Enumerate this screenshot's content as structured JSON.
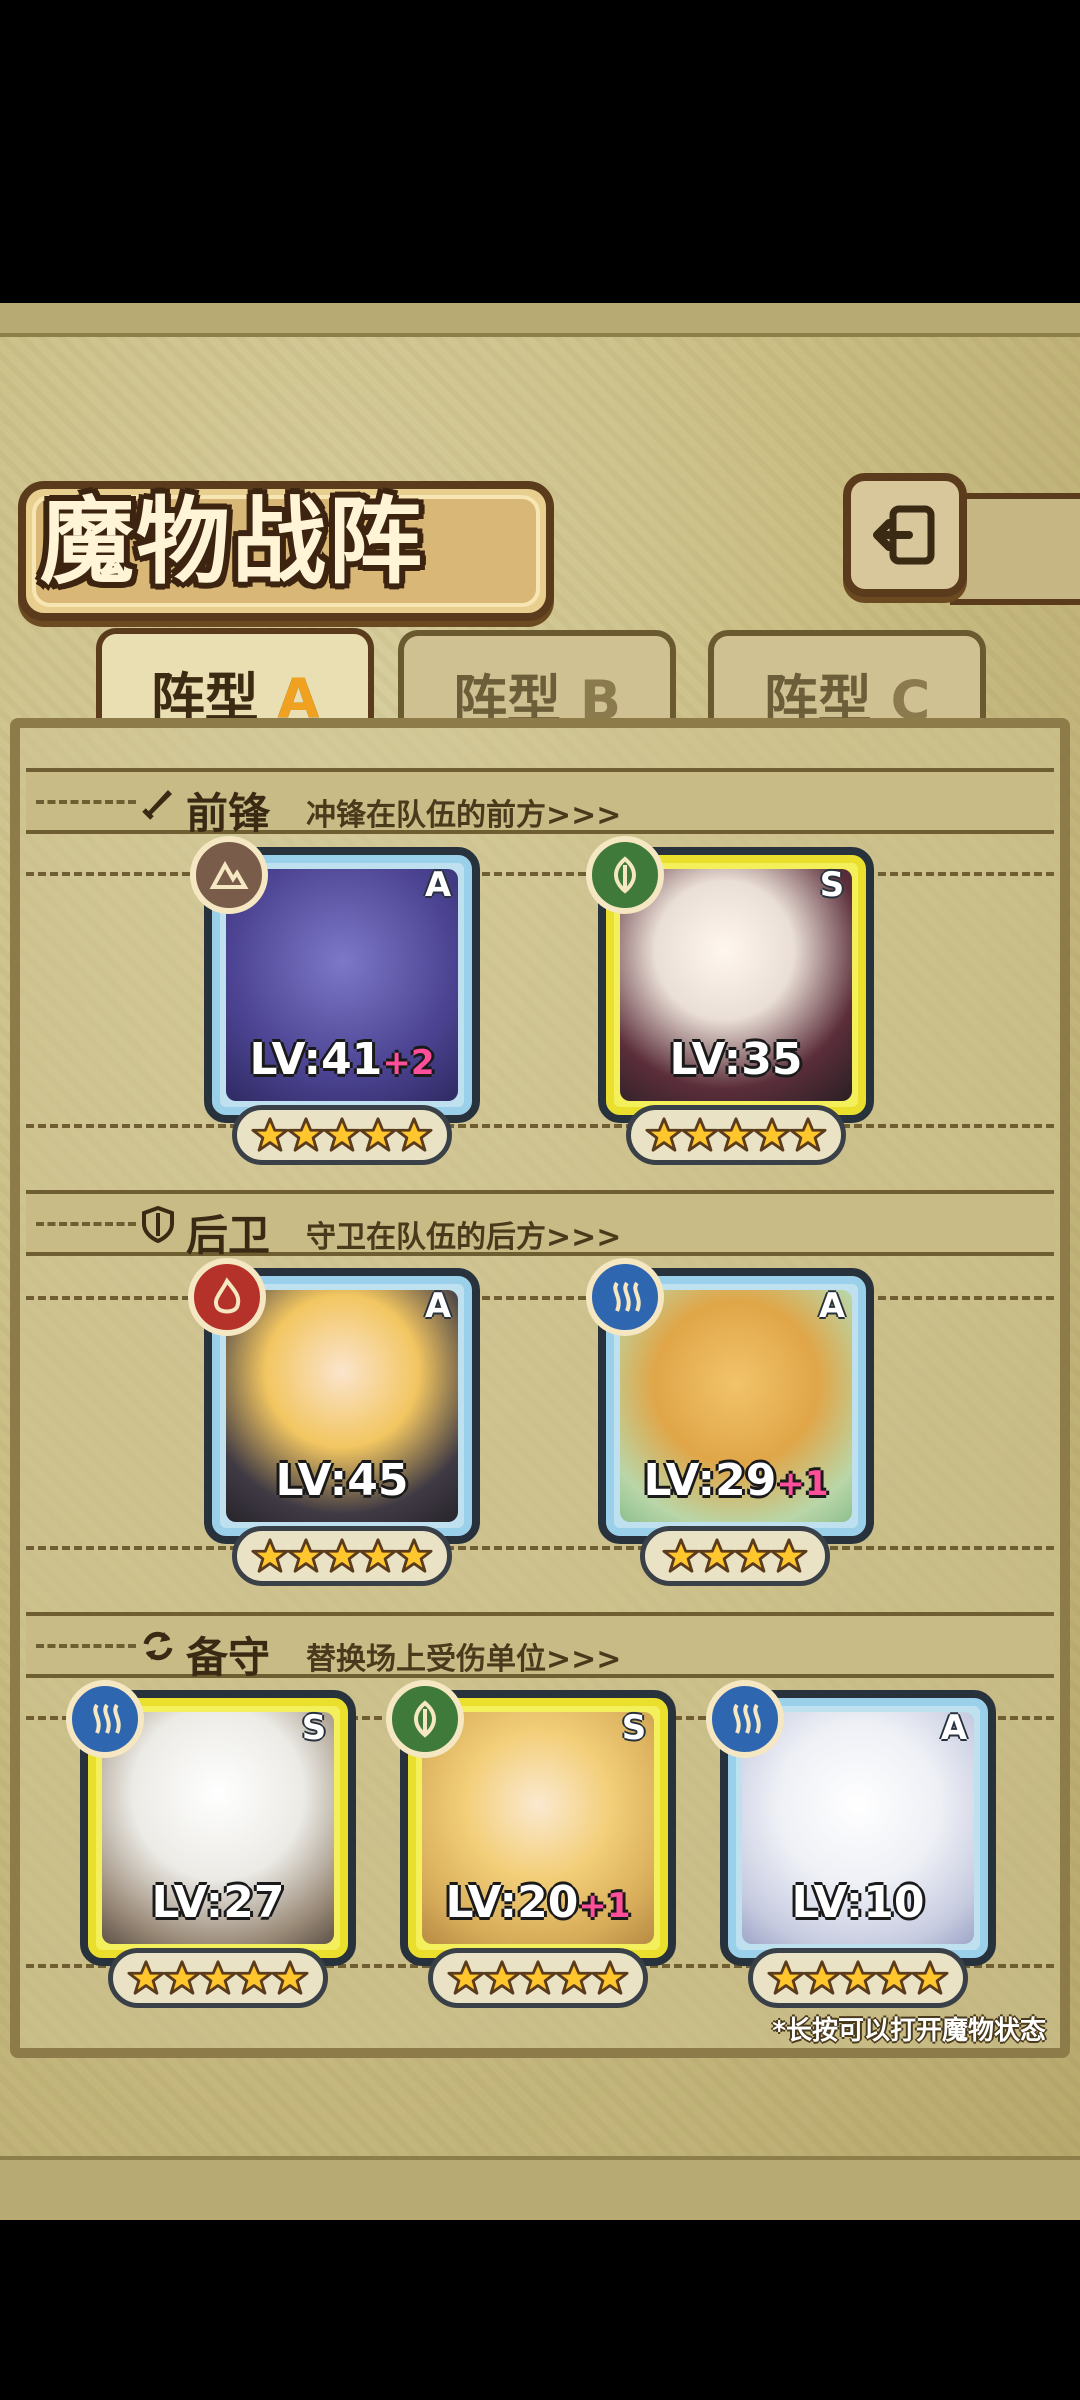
{
  "header": {
    "title": "魔物战阵"
  },
  "tabs": [
    {
      "label": "阵型",
      "letter": "A",
      "active": true
    },
    {
      "label": "阵型",
      "letter": "B",
      "active": false
    },
    {
      "label": "阵型",
      "letter": "C",
      "active": false
    }
  ],
  "sections": {
    "front": {
      "title": "前锋",
      "subtitle": "冲锋在队伍的前方>>>",
      "icon": "sword-icon"
    },
    "back": {
      "title": "后卫",
      "subtitle": "守卫在队伍的后方>>>",
      "icon": "shield-icon"
    },
    "reserve": {
      "title": "备守",
      "subtitle": "替换场上受伤单位>>>",
      "icon": "swap-icon"
    }
  },
  "cards": {
    "front1": {
      "rank": "A",
      "level": "LV:41",
      "bonus": "+2",
      "element": "earth",
      "stars": 5
    },
    "front2": {
      "rank": "S",
      "level": "LV:35",
      "bonus": "",
      "element": "wood",
      "stars": 5
    },
    "back1": {
      "rank": "A",
      "level": "LV:45",
      "bonus": "",
      "element": "fire",
      "stars": 5
    },
    "back2": {
      "rank": "A",
      "level": "LV:29",
      "bonus": "+1",
      "element": "water",
      "stars": 4
    },
    "res1": {
      "rank": "S",
      "level": "LV:27",
      "bonus": "",
      "element": "water",
      "stars": 5
    },
    "res2": {
      "rank": "S",
      "level": "LV:20",
      "bonus": "+1",
      "element": "wood",
      "stars": 5
    },
    "res3": {
      "rank": "A",
      "level": "LV:10",
      "bonus": "",
      "element": "water",
      "stars": 5
    }
  },
  "footer": {
    "hint": "*长按可以打开魔物状态"
  },
  "colors": {
    "accent": "#f0a11f",
    "frame_dark": "#5a3b1c",
    "bonus": "#ff4f9a"
  }
}
